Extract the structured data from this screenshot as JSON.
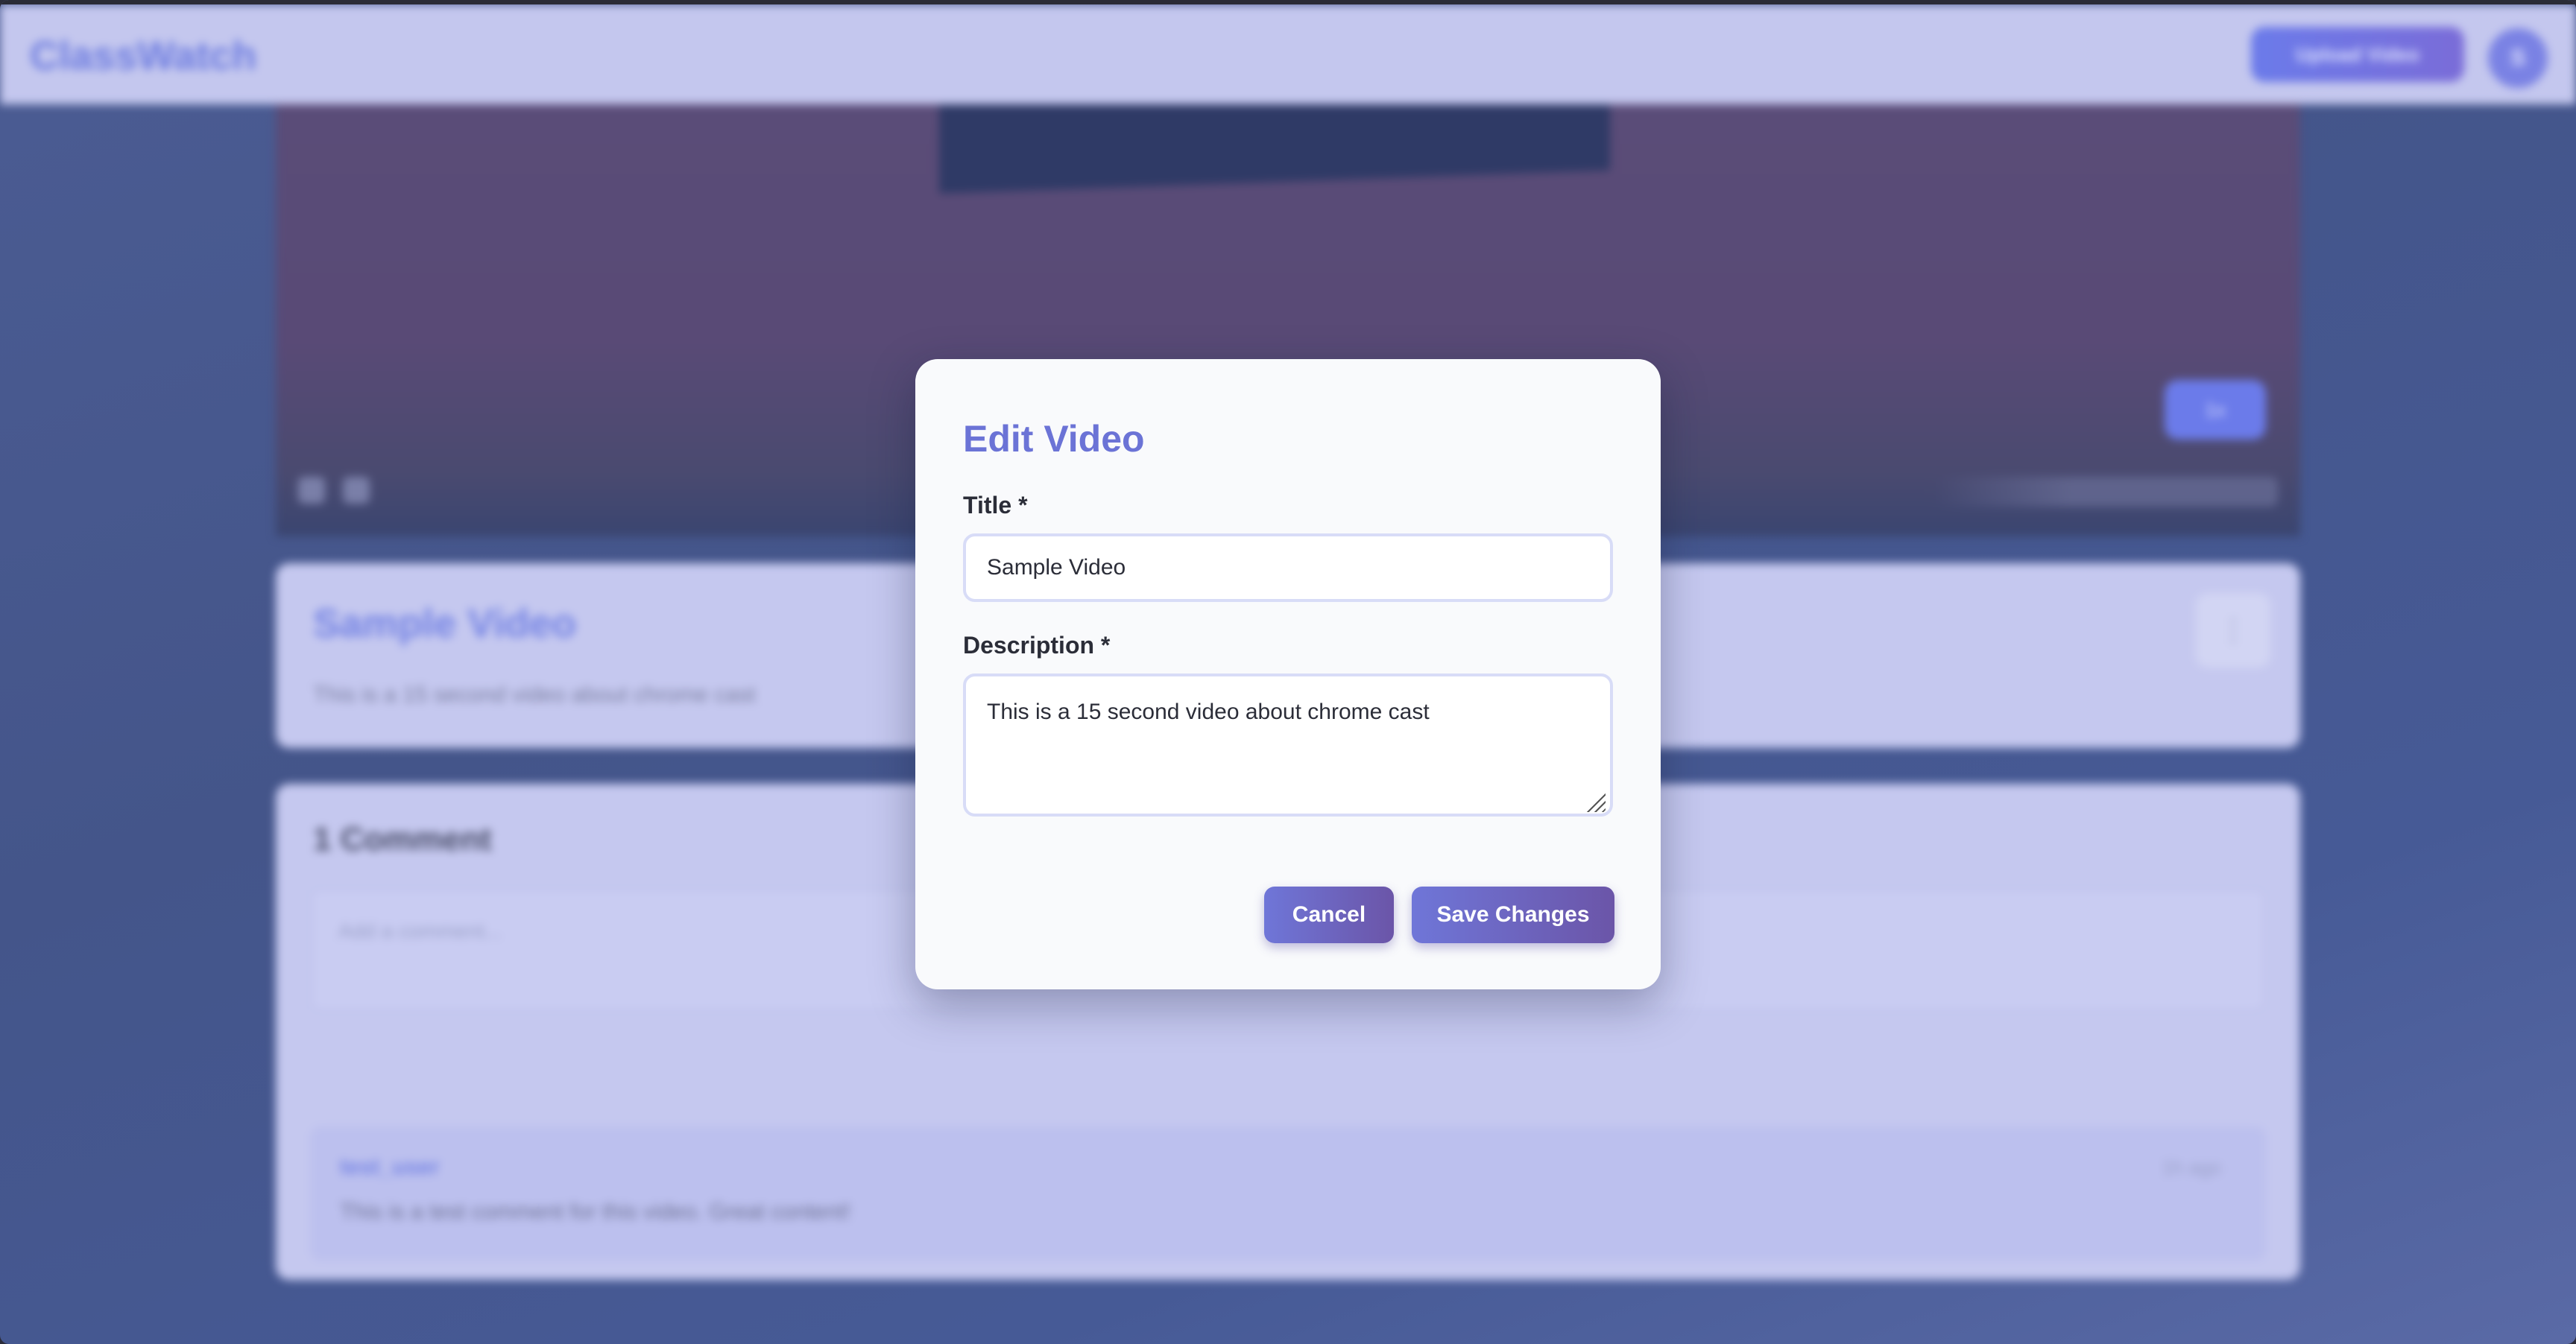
{
  "app": {
    "logo": "ClassWatch"
  },
  "header": {
    "upload_label": "Upload Video",
    "avatar_initial": "S"
  },
  "player": {
    "speed_label": "1x"
  },
  "video": {
    "title": "Sample Video",
    "description": "This is a 15 second video about chrome cast",
    "menu_icon": "more-icon"
  },
  "comments": {
    "heading": "1 Comment",
    "input_placeholder": "Add a comment...",
    "items": [
      {
        "author": "test_user",
        "text": "This is a test comment for this video. Great content!",
        "time": "1h ago"
      }
    ]
  },
  "modal": {
    "title": "Edit Video",
    "title_label": "Title *",
    "title_value": "Sample Video",
    "description_label": "Description *",
    "description_value": "This is a 15 second video about chrome cast",
    "cancel_label": "Cancel",
    "save_label": "Save Changes"
  },
  "colors": {
    "accent": "#6b73d6",
    "button_gradient_start": "#6f76d8",
    "button_gradient_end": "#6b55a8"
  }
}
